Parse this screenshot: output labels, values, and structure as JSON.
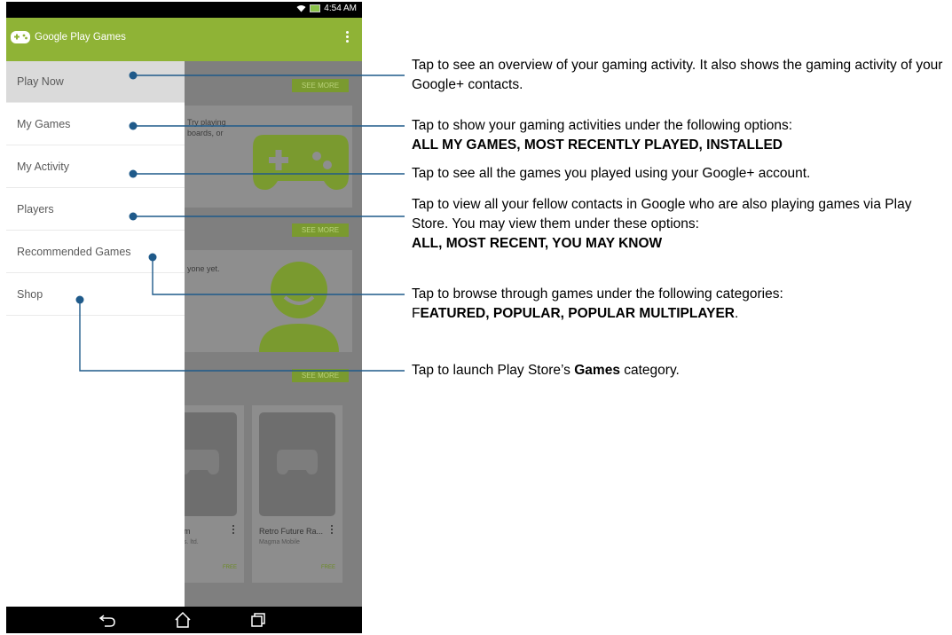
{
  "status_bar": {
    "time": "4:54 AM"
  },
  "app_bar": {
    "title": "Google Play Games"
  },
  "drawer": {
    "items": [
      {
        "label": "Play Now"
      },
      {
        "label": "My Games"
      },
      {
        "label": "My Activity"
      },
      {
        "label": "Players"
      },
      {
        "label": "Recommended Games"
      },
      {
        "label": "Shop"
      }
    ]
  },
  "background": {
    "see_more": "SEE MORE",
    "card1_text_1": "Try playing",
    "card1_text_2": "boards, or",
    "card2_text": "yone yet.",
    "games": [
      {
        "title": "m",
        "developer": "s. ltd.",
        "price": "FREE"
      },
      {
        "title": "Retro Future Ra...",
        "developer": "Magma Mobile",
        "price": "FREE"
      }
    ]
  },
  "annotations": [
    {
      "text": "Tap to see an overview of your gaming activity. It also shows the gaming activity of your  Google+ contacts."
    },
    {
      "text": "Tap to show your gaming activities under the following options:",
      "bold": "ALL MY GAMES, MOST RECENTLY PLAYED, INSTALLED"
    },
    {
      "text": "Tap to see all the games you played using your Google+ account."
    },
    {
      "text": "Tap to view all your fellow contacts in Google who are also playing games via Play Store. You may view them under these options:",
      "bold": "ALL, MOST RECENT, YOU MAY KNOW"
    },
    {
      "text": "Tap to browse through games under the following categories:",
      "bold_prefix": "F",
      "bold": "EATURED, POPULAR, POPULAR MULTIPLAYER",
      "suffix": "."
    },
    {
      "text_before": "Tap to launch Play Store’s ",
      "bold": "Games",
      "text_after": " category."
    }
  ],
  "colors": {
    "accent": "#8fb336",
    "leader_line": "#1f5a8a"
  },
  "icons": [
    "gamepad-icon",
    "overflow-menu-icon",
    "wifi-icon",
    "battery-icon",
    "back-icon",
    "home-icon",
    "recents-icon"
  ]
}
